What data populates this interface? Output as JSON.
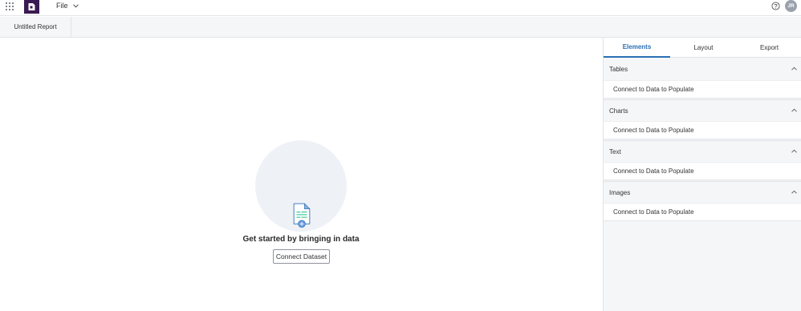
{
  "app": {
    "file_menu_label": "File",
    "avatar_initials": "JR",
    "brand_color": "#3a1a52",
    "accent_color": "#2a6fb5"
  },
  "report_tab": {
    "label": "Untitled Report"
  },
  "canvas": {
    "empty_title": "Get started by bringing in data",
    "connect_button_label": "Connect Dataset"
  },
  "panel": {
    "tabs": [
      {
        "label": "Elements",
        "active": true
      },
      {
        "label": "Layout",
        "active": false
      },
      {
        "label": "Export",
        "active": false
      }
    ],
    "sections": [
      {
        "title": "Tables",
        "body": "Connect to Data to Populate",
        "expanded": true
      },
      {
        "title": "Charts",
        "body": "Connect to Data to Populate",
        "expanded": true
      },
      {
        "title": "Text",
        "body": "Connect to Data to Populate",
        "expanded": true
      },
      {
        "title": "Images",
        "body": "Connect to Data to Populate",
        "expanded": true
      }
    ]
  }
}
